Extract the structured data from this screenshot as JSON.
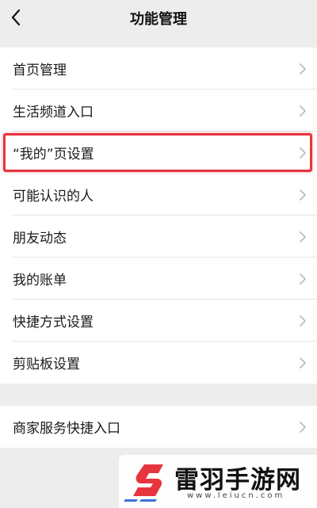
{
  "header": {
    "title": "功能管理"
  },
  "group1": {
    "items": [
      {
        "label": "首页管理"
      },
      {
        "label": "生活频道入口"
      },
      {
        "label": "“我的”页设置"
      },
      {
        "label": "可能认识的人"
      },
      {
        "label": "朋友动态"
      },
      {
        "label": "我的账单"
      },
      {
        "label": "快捷方式设置"
      },
      {
        "label": "剪贴板设置"
      }
    ]
  },
  "group2": {
    "items": [
      {
        "label": "商家服务快捷入口"
      }
    ]
  },
  "highlight": {
    "color": "#e8343f"
  },
  "watermark": {
    "name": "雷羽手游网",
    "url": "www.leiucn.com",
    "brand_color": "#e8343f",
    "accent_color": "#3b6fd8"
  },
  "icons": {
    "back": "chevron-left-icon",
    "row": "chevron-right-icon"
  }
}
